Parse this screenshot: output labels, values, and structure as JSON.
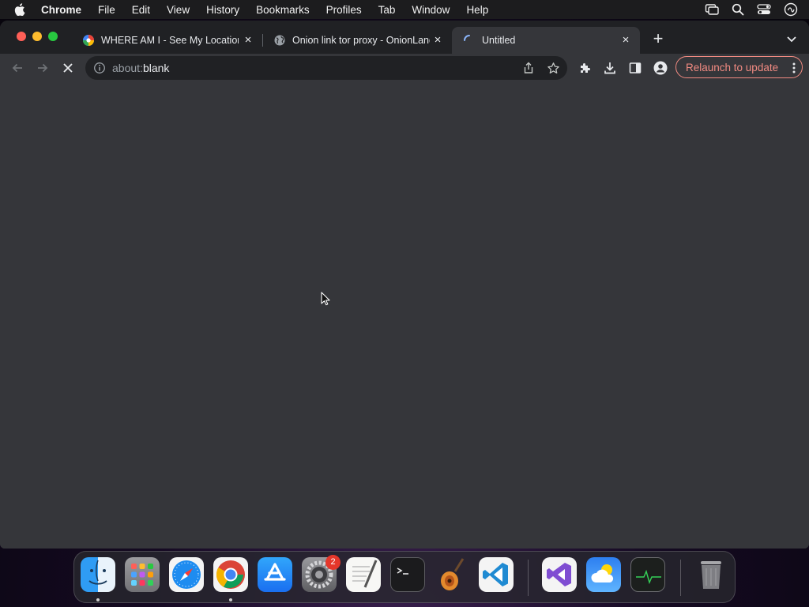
{
  "menubar": {
    "app_name": "Chrome",
    "items": [
      "File",
      "Edit",
      "View",
      "History",
      "Bookmarks",
      "Profiles",
      "Tab",
      "Window",
      "Help"
    ]
  },
  "tabs": [
    {
      "title": "WHERE AM I - See My Location",
      "close": "×",
      "favicon": "whereami-favicon"
    },
    {
      "title": "Onion link tor proxy - OnionLand",
      "close": "×",
      "favicon": "globe-favicon"
    },
    {
      "title": "Untitled",
      "close": "×",
      "favicon": "loading-spinner",
      "active": true
    }
  ],
  "new_tab": "+",
  "omnibox": {
    "scheme": "about:",
    "host": "blank"
  },
  "relaunch_label": "Relaunch to update",
  "dock": {
    "apps": [
      "Finder",
      "Launchpad",
      "Safari",
      "Google Chrome",
      "App Store",
      "System Preferences",
      "TextEdit",
      "Terminal",
      "GarageBand",
      "Visual Studio Code",
      "Visual Studio",
      "Weather",
      "Activity Monitor",
      "Trash"
    ],
    "system_preferences_badge": "2"
  },
  "colors": {
    "tab_strip": "#202124",
    "toolbar": "#35363a",
    "relaunch": "#f28b82"
  }
}
